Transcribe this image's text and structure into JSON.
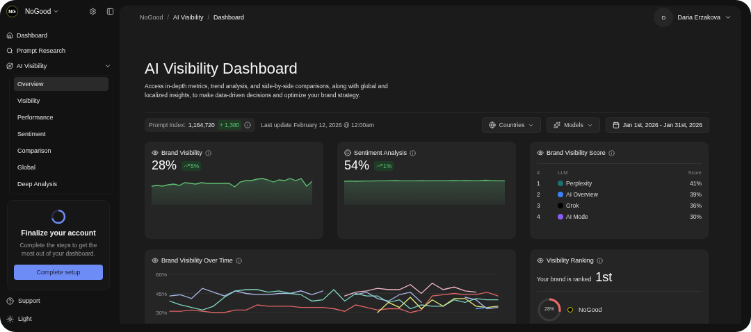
{
  "workspace": {
    "name": "NoGood",
    "logo": "NG"
  },
  "sidebar": {
    "items": [
      {
        "label": "Dashboard",
        "selected": false
      },
      {
        "label": "Prompt Research",
        "selected": false
      },
      {
        "label": "AI Visibility",
        "selected": false,
        "expanded": true,
        "children": [
          {
            "label": "Overview",
            "selected": true
          },
          {
            "label": "Visibility",
            "selected": false
          },
          {
            "label": "Performance",
            "selected": false
          },
          {
            "label": "Sentiment",
            "selected": false
          },
          {
            "label": "Comparison",
            "selected": false
          },
          {
            "label": "Global",
            "selected": false
          },
          {
            "label": "Deep Analysis",
            "selected": false
          }
        ]
      }
    ]
  },
  "setup_card": {
    "title": "Finalize your account",
    "text": "Complete the steps to get the most out of your dashboard.",
    "button": "Complete setup"
  },
  "sidebar_footer": [
    {
      "label": "Support"
    },
    {
      "label": "Light"
    }
  ],
  "breadcrumb": {
    "separator": "/",
    "items": [
      "NoGood",
      "AI Visibility",
      "Dashboard"
    ]
  },
  "user": {
    "initial": "D",
    "name": "Daria Erzakova"
  },
  "page": {
    "title": "AI Visibility Dashboard",
    "description": "Access in-depth metrics, trend analysis, and side-by-side comparisons, along with global and localized insights, to make data-driven decisions and optimize your brand strategy."
  },
  "toolbar": {
    "prompt_index_label": "Prompt Index:",
    "prompt_index": "1,164,720",
    "delta": "+ 1,380",
    "last_update": "Last update February 12, 2026 @ 12:00am",
    "filters": [
      "Countries",
      "Models"
    ],
    "date_range": "Jan 1st, 2026 - Jan 31st, 2026"
  },
  "metrics": [
    {
      "title": "Brand Visibility",
      "value": "28%",
      "change": "5%"
    },
    {
      "title": "Sentiment Analysis",
      "value": "54%",
      "change": "1%"
    }
  ],
  "score_card": {
    "title": "Brand Visibility Score",
    "columns": [
      "#",
      "LLM",
      "Score"
    ],
    "rows": [
      {
        "rank": "1",
        "llm": "Perplexity",
        "score": "41%",
        "color": "#1f6f6f"
      },
      {
        "rank": "2",
        "llm": "AI Overview",
        "score": "39%",
        "color": "#3b82f6"
      },
      {
        "rank": "3",
        "llm": "Grok",
        "score": "36%",
        "color": "#000000"
      },
      {
        "rank": "4",
        "llm": "AI Mode",
        "score": "30%",
        "color": "#8b5cf6"
      }
    ]
  },
  "over_time": {
    "title": "Brand Visibility Over Time",
    "chart_data": {
      "type": "line",
      "ylim": [
        30,
        60
      ],
      "yticks": [
        {
          "value": 30,
          "label": "30%"
        },
        {
          "value": 45,
          "label": "45%"
        },
        {
          "value": 60,
          "label": "60%"
        }
      ],
      "series": [
        {
          "color": "#a9b8e8",
          "values": [
            43,
            44,
            41,
            49,
            46,
            43,
            47,
            45,
            44,
            44,
            45,
            45,
            47,
            44,
            47,
            null,
            null,
            44,
            46,
            41,
            39,
            44,
            46,
            38,
            null,
            null,
            null,
            42,
            40,
            33,
            34
          ]
        },
        {
          "color": "#7fd6c4",
          "values": [
            39,
            36,
            34,
            32,
            35,
            42,
            47,
            48,
            48,
            46,
            47,
            45,
            44,
            39,
            40,
            48,
            39,
            45,
            43,
            43,
            38,
            40,
            33,
            36,
            35,
            35,
            40,
            38,
            41,
            40,
            40
          ]
        },
        {
          "color": "#e06464",
          "values": [
            31,
            31,
            32,
            31,
            30,
            30,
            32,
            32,
            36,
            35,
            35,
            35,
            34,
            34,
            34,
            33,
            31,
            36,
            34,
            32,
            33,
            33,
            30,
            32,
            43,
            44,
            45,
            44,
            44,
            46,
            43
          ]
        },
        {
          "color": "#f2b8cb",
          "values": [
            null,
            null,
            null,
            null,
            null,
            null,
            null,
            null,
            null,
            null,
            null,
            null,
            null,
            null,
            null,
            null,
            43,
            46,
            47,
            49,
            48,
            48,
            52,
            45,
            53,
            48,
            50,
            47,
            46,
            null,
            null
          ]
        },
        {
          "color": "#e3ea7c",
          "values": [
            null,
            null,
            null,
            null,
            null,
            null,
            null,
            null,
            null,
            null,
            null,
            null,
            null,
            null,
            null,
            null,
            null,
            null,
            null,
            30,
            38,
            34,
            42,
            33,
            40,
            35,
            41,
            41,
            35,
            34,
            35
          ]
        },
        {
          "color": "#5c9ef2",
          "values": [
            null,
            null,
            null,
            null,
            null,
            null,
            null,
            null,
            null,
            null,
            null,
            null,
            null,
            null,
            null,
            null,
            null,
            null,
            null,
            null,
            null,
            null,
            null,
            null,
            null,
            null,
            null,
            null,
            33,
            34,
            null
          ]
        }
      ]
    }
  },
  "ranking": {
    "title": "Visibility Ranking",
    "label": "Your brand is ranked",
    "rank": "1st",
    "brand": "NoGood",
    "share": "28%"
  }
}
